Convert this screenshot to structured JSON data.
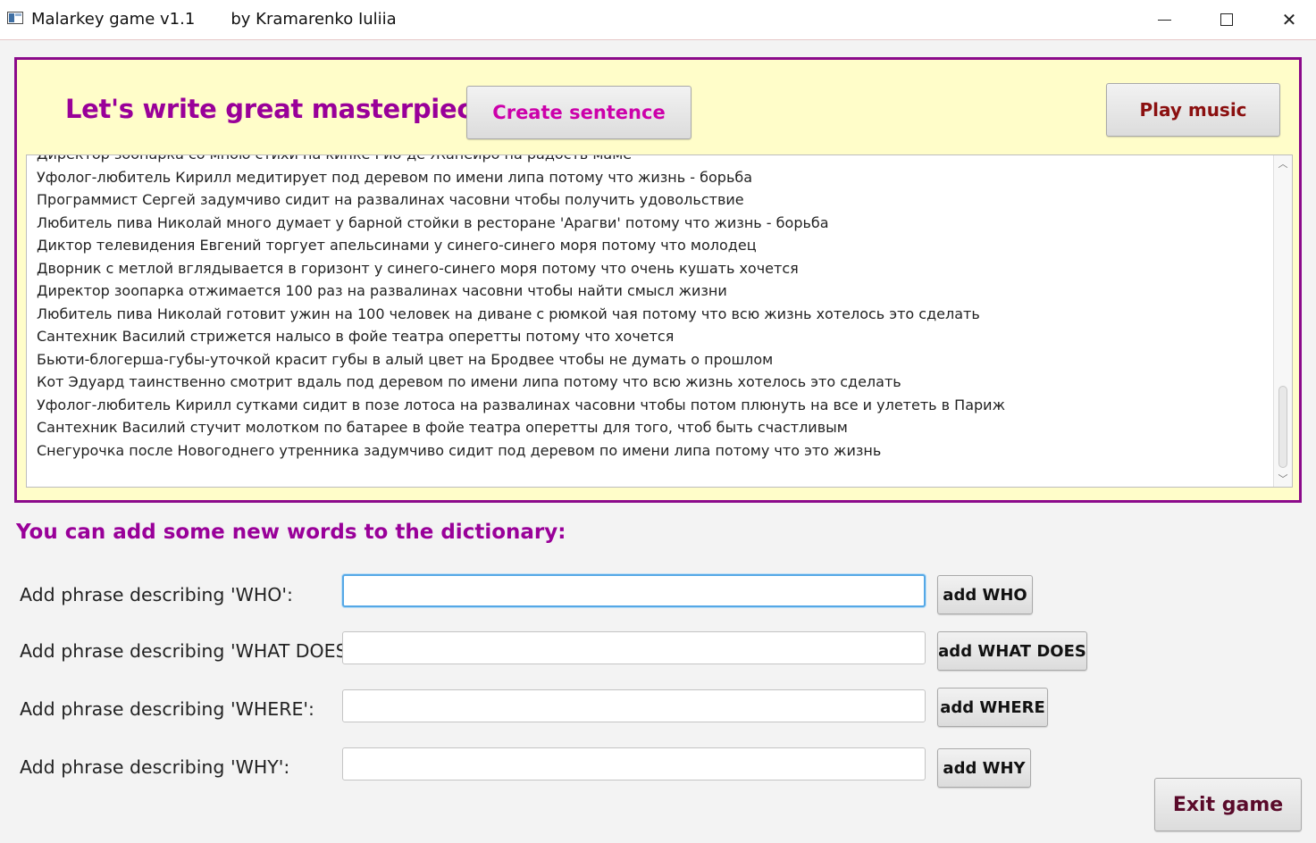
{
  "window": {
    "title": "Malarkey game v1.1       by Kramarenko Iuliia",
    "controls": {
      "minimize": "minimize",
      "maximize": "maximize",
      "close": "close"
    }
  },
  "top_panel": {
    "heading": "Let's write great masterpiece!",
    "create_button": "Create sentence",
    "music_button": "Play music",
    "sentences": [
      "Директор зоопарка со мною стихи на кинке Рио-де-Жанейро на радость маме",
      "Уфолог-любитель Кирилл медитирует под деревом по имени липа потому что жизнь - борьба",
      "Программист Сергей задумчиво сидит на развалинах часовни чтобы получить удовольствие",
      "Любитель пива Николай много думает у барной стойки в ресторане 'Арагви' потому что жизнь - борьба",
      "Диктор телевидения Евгений торгует апельсинами у синего-синего моря потому что молодец",
      "Дворник с метлой вглядывается в горизонт у синего-синего моря потому что очень кушать хочется",
      "Директор зоопарка отжимается 100 раз на развалинах часовни чтобы найти смысл жизни",
      "Любитель пива Николай готовит ужин на 100 человек на диване с рюмкой чая потому что всю жизнь хотелось это сделать",
      "Сантехник Василий стрижется налысо в фойе театра оперетты потому что хочется",
      "Бьюти-блогерша-губы-уточкой красит губы в алый цвет на Бродвее чтобы не думать о прошлом",
      "Кот Эдуард таинственно смотрит вдаль под деревом по имени липа потому что всю жизнь хотелось это сделать",
      "Уфолог-любитель Кирилл сутками сидит в позе лотоса на развалинах часовни чтобы потом плюнуть на все и улететь в Париж",
      "Сантехник Василий стучит молотком по батарее в фойе театра оперетты для того, чтоб быть счастливым",
      "Снегурочка после Новогоднего утренника задумчиво сидит под деревом по имени липа потому что это жизнь"
    ]
  },
  "dictionary": {
    "heading": "You can add some new words to the dictionary:",
    "rows": [
      {
        "label": "Add phrase describing 'WHO':",
        "value": "",
        "button": "add WHO"
      },
      {
        "label": "Add phrase describing 'WHAT DOES':",
        "value": "",
        "button": "add WHAT DOES"
      },
      {
        "label": "Add phrase describing 'WHERE':",
        "value": "",
        "button": "add WHERE"
      },
      {
        "label": "Add phrase describing 'WHY':",
        "value": "",
        "button": "add WHY"
      }
    ]
  },
  "exit_button": "Exit game"
}
